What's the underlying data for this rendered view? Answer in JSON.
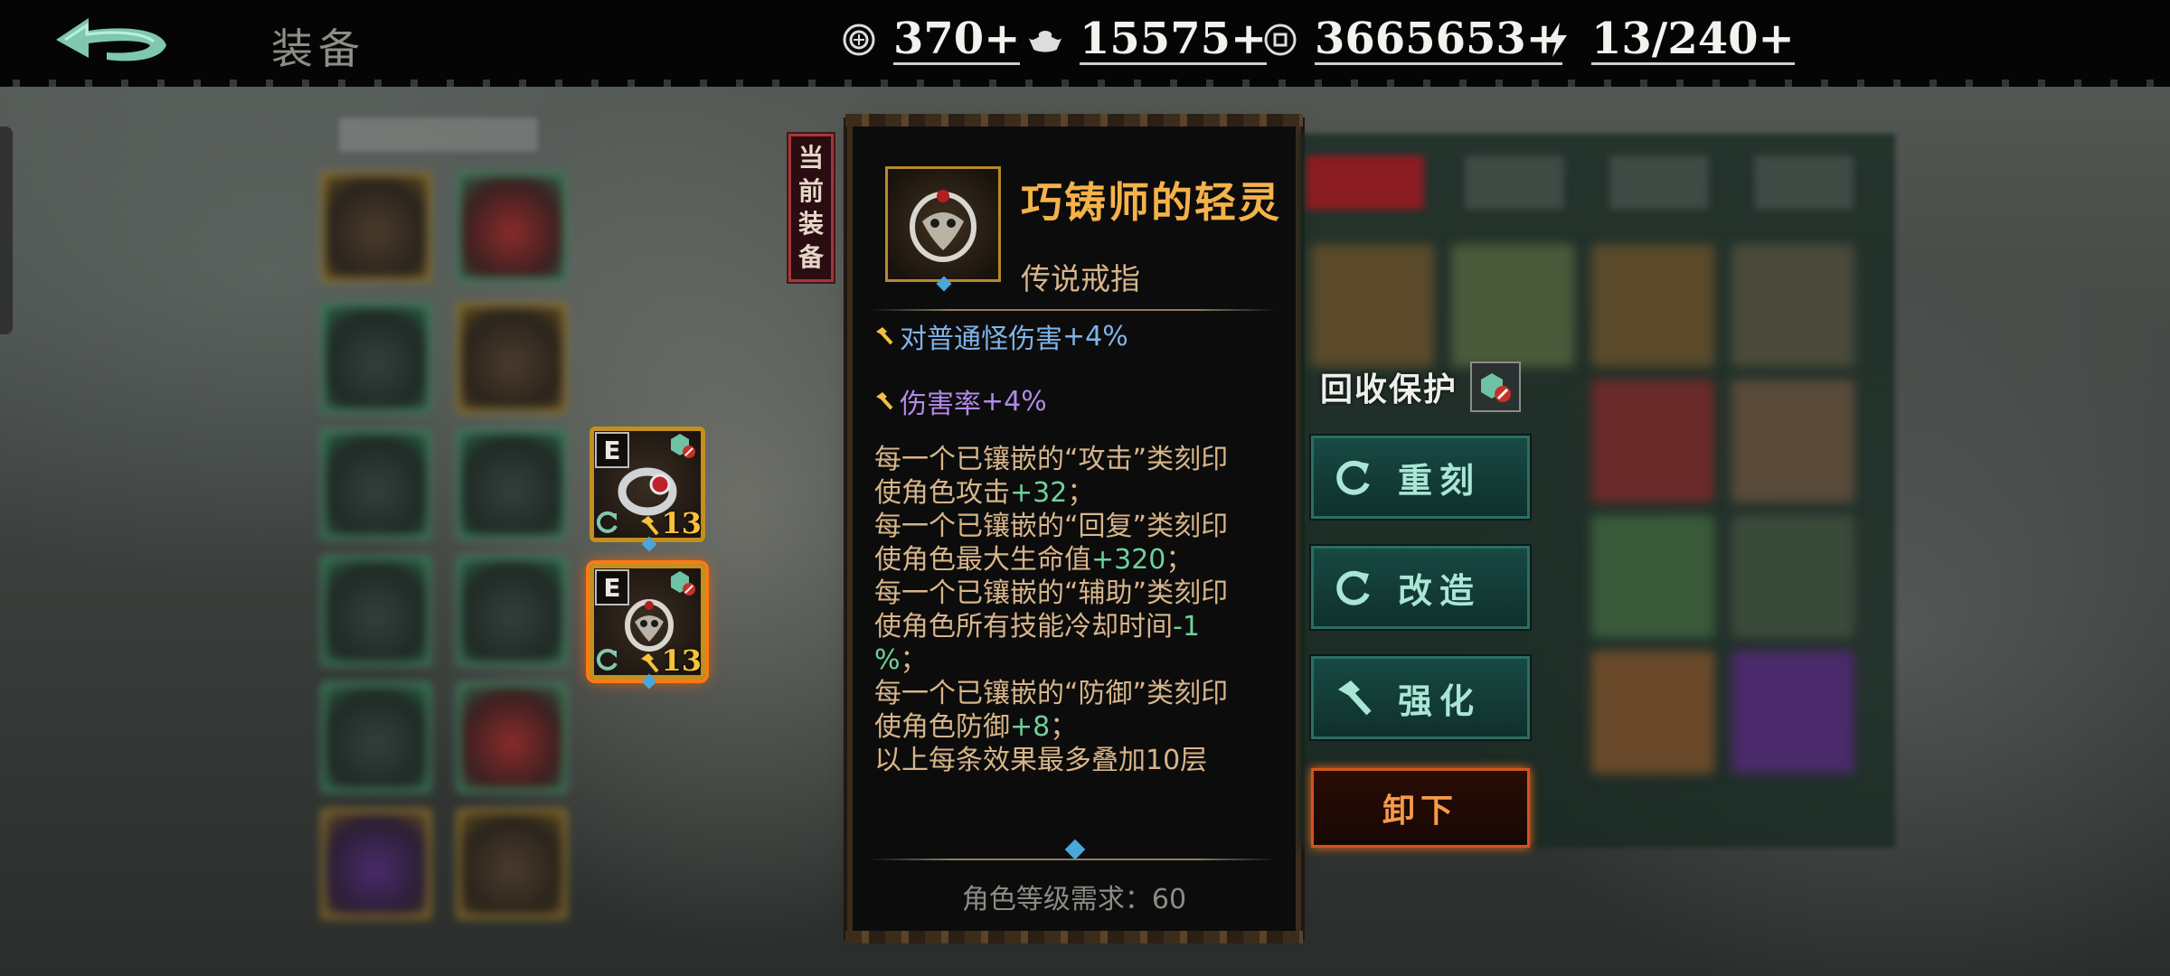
{
  "header": {
    "title": "装备",
    "resources": [
      {
        "icon": "coin-token-icon",
        "value": "370+"
      },
      {
        "icon": "silver-ingot-icon",
        "value": "15575+"
      },
      {
        "icon": "copper-coin-icon",
        "value": "3665653+"
      },
      {
        "icon": "lightning-energy-icon",
        "value": "13/240+"
      }
    ]
  },
  "equipped": [
    {
      "slot": "E",
      "level": "13",
      "icon": "ring-silver-icon"
    },
    {
      "slot": "E",
      "level": "13",
      "icon": "ring-mask-icon",
      "selected": true
    }
  ],
  "current_tag": [
    "当",
    "前",
    "装",
    "备"
  ],
  "item": {
    "name": "巧铸师的轻灵",
    "type": "传说戒指",
    "affixes": [
      {
        "label": "对普通怪伤害",
        "value": "+4%",
        "color": "#7fb4e8"
      },
      {
        "label": "伤害率",
        "value": "+4%",
        "color": "#b28ae8"
      }
    ],
    "description": [
      {
        "text": "每一个已镶嵌的“攻击”类刻印",
        "value": ""
      },
      {
        "text": "使角色攻击",
        "value": "+32",
        "suffix": "；"
      },
      {
        "text": "每一个已镶嵌的“回复”类刻印",
        "value": ""
      },
      {
        "text": "使角色最大生命值",
        "value": "+320",
        "suffix": "；"
      },
      {
        "text": "每一个已镶嵌的“辅助”类刻印",
        "value": ""
      },
      {
        "text": "使角色所有技能冷却时间",
        "value": "-1",
        "suffix": ""
      },
      {
        "text": "",
        "value": "%",
        "suffix": "；"
      },
      {
        "text": "每一个已镶嵌的“防御”类刻印",
        "value": ""
      },
      {
        "text": "使角色防御",
        "value": "+8",
        "suffix": "；"
      },
      {
        "text": "以上每条效果最多叠加10层",
        "value": ""
      }
    ],
    "requirement": "角色等级需求：60"
  },
  "actions": {
    "protect_label": "回收保护",
    "reforge": "重刻",
    "modify": "改造",
    "enhance": "强化",
    "unequip": "卸下"
  },
  "colors": {
    "gold": "#f4b24a",
    "tan": "#d8b58a",
    "green_value": "#6fd09a",
    "button_teal": "#184a44",
    "unequip_orange": "#d2541c"
  }
}
